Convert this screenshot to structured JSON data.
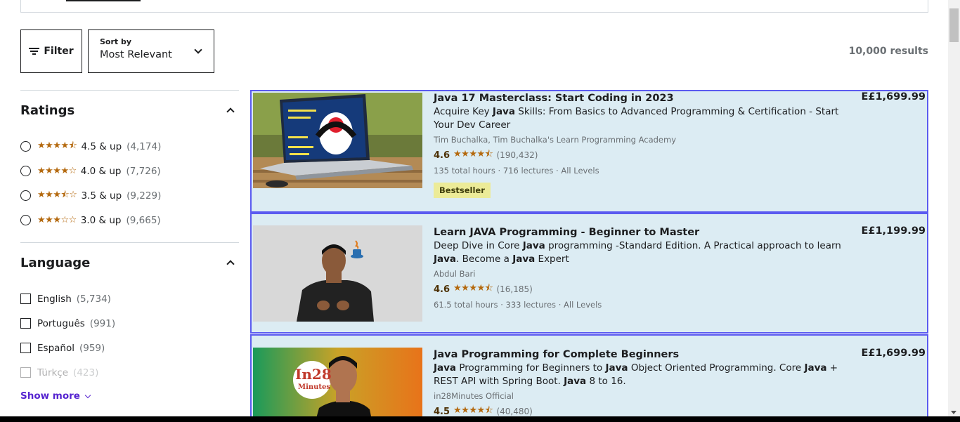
{
  "toolbar": {
    "filter_label": "Filter",
    "sort_label": "Sort by",
    "sort_value": "Most Relevant",
    "results": "10,000 results"
  },
  "sidebar": {
    "ratings": {
      "title": "Ratings",
      "items": [
        {
          "stars": "★★★★⯪",
          "label": "4.5 & up",
          "count": "(4,174)"
        },
        {
          "stars": "★★★★☆",
          "label": "4.0 & up",
          "count": "(7,726)"
        },
        {
          "stars": "★★★⯪☆",
          "label": "3.5 & up",
          "count": "(9,229)"
        },
        {
          "stars": "★★★☆☆",
          "label": "3.0 & up",
          "count": "(9,665)"
        }
      ]
    },
    "language": {
      "title": "Language",
      "items": [
        {
          "label": "English",
          "count": "(5,734)"
        },
        {
          "label": "Português",
          "count": "(991)"
        },
        {
          "label": "Español",
          "count": "(959)"
        },
        {
          "label": "Türkçe",
          "count": "(423)"
        }
      ],
      "show_more": "Show more"
    }
  },
  "courses": [
    {
      "title": "Java 17 Masterclass: Start Coding in 2023",
      "instructors": "Tim Buchalka, Tim Buchalka's Learn Programming Academy",
      "rating": "4.6",
      "stars": "★★★★⯪",
      "reviews": "(190,432)",
      "meta": "135 total hours · 716 lectures · All Levels",
      "badge": "Bestseller",
      "price": "E£1,699.99"
    },
    {
      "title": "Learn JAVA Programming - Beginner to Master",
      "instructors": "Abdul Bari",
      "rating": "4.6",
      "stars": "★★★★⯪",
      "reviews": "(16,185)",
      "meta": "61.5 total hours · 333 lectures · All Levels",
      "price": "E£1,199.99"
    },
    {
      "title": "Java Programming for Complete Beginners",
      "instructors": "in28Minutes Official",
      "rating": "4.5",
      "stars": "★★★★⯪",
      "reviews": "(40,480)",
      "price": "E£1,699.99",
      "thumb_text_1": "In28",
      "thumb_text_2": "Minutes"
    }
  ],
  "colors": {
    "accent": "#5624d0",
    "star": "#b4690e",
    "card_bg": "#dcecf3",
    "card_border": "#5b5bf0",
    "badge_bg": "#eceb98"
  }
}
